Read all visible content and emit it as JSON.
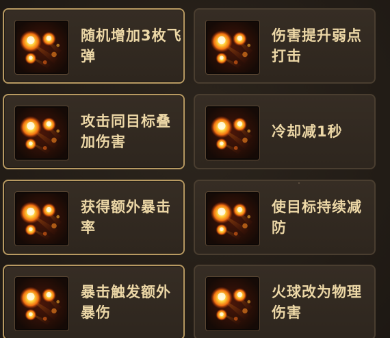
{
  "skills": [
    {
      "label": "随机增加3枚飞弹",
      "icon": "fireball-icon",
      "selected": true
    },
    {
      "label": "伤害提升弱点打击",
      "icon": "fireball-icon",
      "selected": false
    },
    {
      "label": "攻击同目标叠加伤害",
      "icon": "fireball-icon",
      "selected": true
    },
    {
      "label": "冷却减1秒",
      "icon": "fireball-icon",
      "selected": false
    },
    {
      "label": "获得额外暴击率",
      "icon": "fireball-icon",
      "selected": true
    },
    {
      "label": "使目标持续减防",
      "icon": "fireball-icon",
      "selected": false
    },
    {
      "label": "暴击触发额外暴伤",
      "icon": "fireball-icon",
      "selected": true
    },
    {
      "label": "火球改为物理伤害",
      "icon": "fireball-icon",
      "selected": false
    }
  ],
  "colors": {
    "selected_border": "#b89a62",
    "unselected_border": "#4a3e30",
    "label_text": "#ecd7a6",
    "card_bg": "#322920"
  }
}
